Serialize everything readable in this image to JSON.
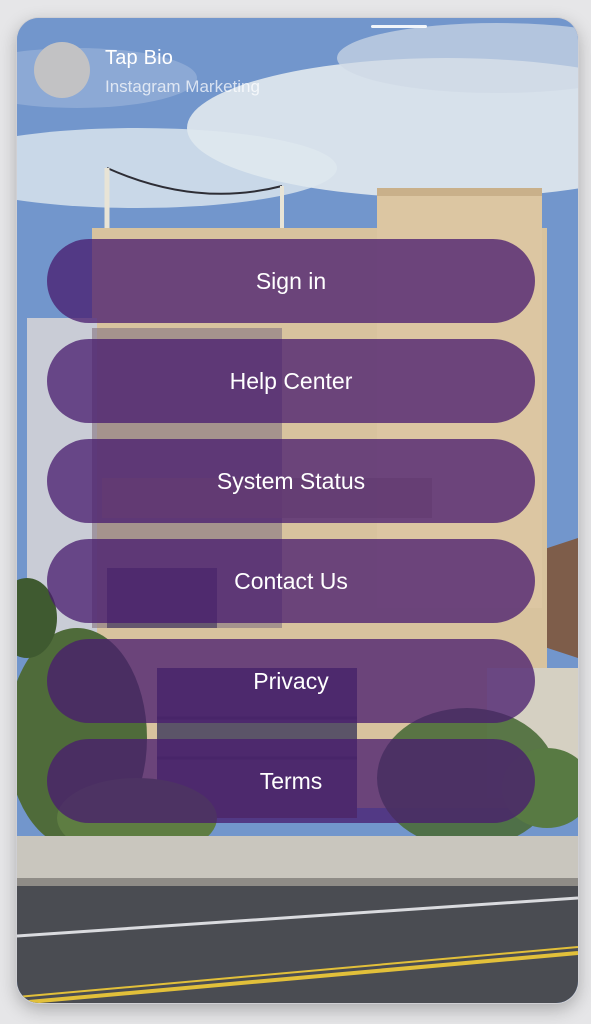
{
  "profile": {
    "name": "Tap Bio",
    "subtitle": "Instagram Marketing"
  },
  "menu": {
    "items": [
      {
        "label": "Sign in"
      },
      {
        "label": "Help Center"
      },
      {
        "label": "System Status"
      },
      {
        "label": "Contact Us"
      },
      {
        "label": "Privacy"
      },
      {
        "label": "Terms"
      }
    ]
  },
  "colors": {
    "button_fill": "#481c6e",
    "page_background": "#e6e6e8",
    "sky": "#6f93c8"
  }
}
